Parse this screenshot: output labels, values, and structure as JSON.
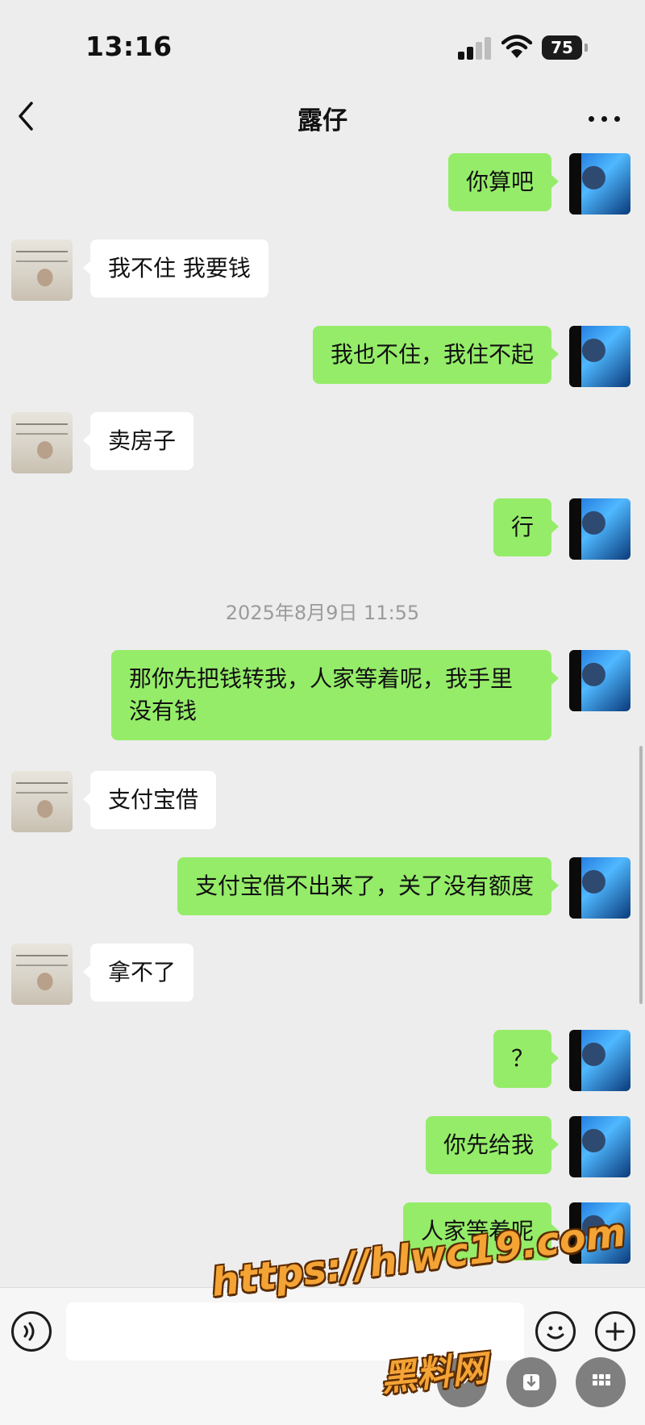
{
  "status_bar": {
    "time": "13:16",
    "battery": "75"
  },
  "nav": {
    "title": "露仔"
  },
  "messages": [
    {
      "from": "me",
      "text": "你算吧"
    },
    {
      "from": "them",
      "text": "我不住 我要钱"
    },
    {
      "from": "me",
      "text": "我也不住，我住不起"
    },
    {
      "from": "them",
      "text": "卖房子"
    },
    {
      "from": "me",
      "text": "行"
    },
    {
      "type": "timestamp",
      "text": "2025年8月9日 11:55"
    },
    {
      "from": "me",
      "text": "那你先把钱转我，人家等着呢，我手里没有钱"
    },
    {
      "from": "them",
      "text": "支付宝借"
    },
    {
      "from": "me",
      "text": "支付宝借不出来了，关了没有额度"
    },
    {
      "from": "them",
      "text": "拿不了"
    },
    {
      "from": "me",
      "text": "？"
    },
    {
      "from": "me",
      "text": "你先给我"
    },
    {
      "from": "me",
      "text": "人家等着呢"
    }
  ],
  "watermark": {
    "url": "https://hlwc19.com",
    "brand": "黑料网"
  },
  "input": {
    "value": ""
  },
  "colors": {
    "my_bubble": "#95ec69",
    "their_bubble": "#ffffff",
    "background": "#ededed"
  }
}
